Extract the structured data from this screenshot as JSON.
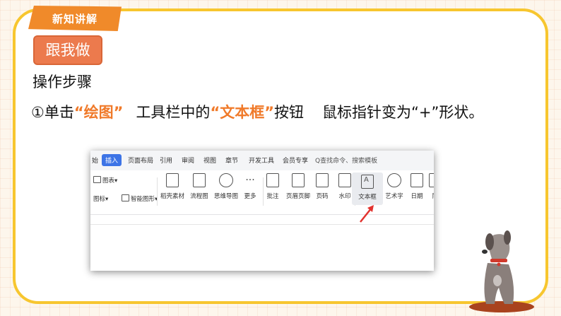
{
  "header": {
    "section_tag": "新知讲解",
    "follow_button": "跟我做"
  },
  "content": {
    "steps_title": "操作步骤",
    "step_prefix": "①单击",
    "draw_quote": "“绘图”",
    "toolbar_mid": "工具栏中的",
    "textbox_quote": "“文本框”",
    "button_word": "按钮",
    "cursor_text": "鼠标指针变为“+”形状。"
  },
  "screenshot": {
    "tabs": [
      "始",
      "插入",
      "页面布局",
      "引用",
      "审阅",
      "视图",
      "章节",
      "开发工具",
      "会员专享"
    ],
    "active_tab": "插入",
    "search_placeholder": "Q查找命令、搜索模板",
    "small_items": {
      "chart": "图表",
      "icon": "图标",
      "smart_art": "智能图形"
    },
    "buttons": [
      "稻壳素材",
      "流程图",
      "思维导图",
      "更多",
      "批注",
      "页眉页脚",
      "页码",
      "水印",
      "文本框",
      "艺术字",
      "日期",
      "附"
    ],
    "more_dots": "···",
    "highlighted_button": "文本框",
    "arrow_color": "#e2322e"
  },
  "colors": {
    "accent_orange": "#f07a2a",
    "card_border": "#f7c62f",
    "button_bg": "#ec7a4d",
    "tab_blue": "#3d74e6"
  }
}
